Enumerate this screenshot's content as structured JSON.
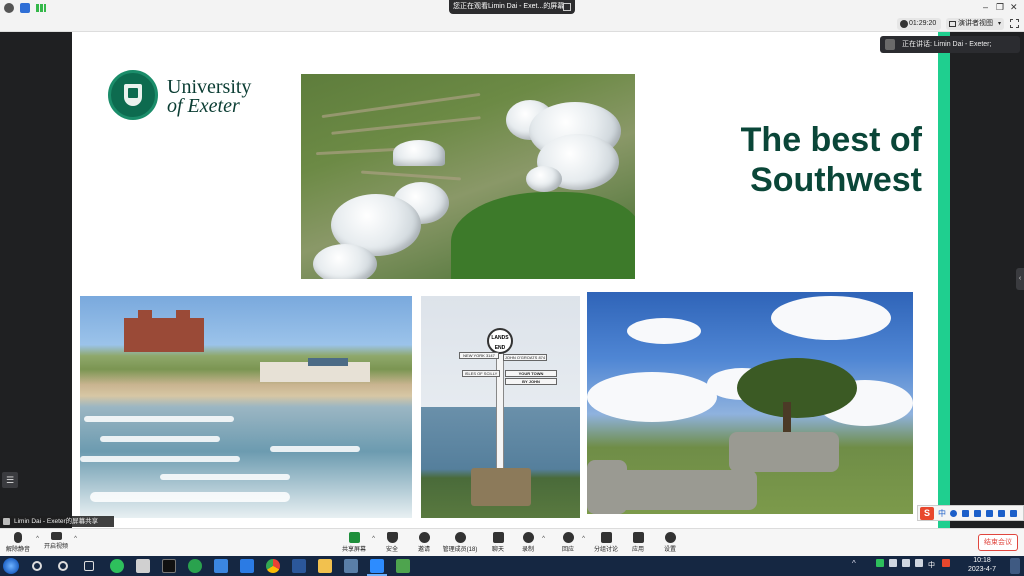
{
  "top_bar": {
    "share_banner": "您正在观看Limin Dai - Exet...的屏幕",
    "window_controls": [
      "–",
      "❐",
      "✕"
    ]
  },
  "sub_bar": {
    "timer": "01:29:20",
    "view_button": "演讲者视图"
  },
  "speaker_pill": "正在讲话: Limin Dai - Exeter;",
  "name_tag": "Limin Dai - Exeter的屏幕共享",
  "slide": {
    "university_line1": "University",
    "university_line2": "of Exeter",
    "title": "The best of Southwest",
    "accent_color": "#1fcf8f",
    "title_color": "#0a4638",
    "sign": {
      "top": "LANDS END",
      "arm1": "NEW YORK 3147",
      "arm2": "JOHN O'GROATS 874",
      "arm3": "ISLES OF SCILLY",
      "arm4": "YOUR TOWN",
      "arm5": "BY JOHN"
    }
  },
  "toolbar": {
    "unmute": "解除静音",
    "start_video": "开启视频",
    "share_screen": "共享屏幕",
    "security": "安全",
    "invite": "邀请",
    "manage_participants": "管理成员(18)",
    "chat": "聊天",
    "record": "录制",
    "reactions": "回应",
    "breakout": "分组讨论",
    "apps": "应用",
    "settings": "设置",
    "end_meeting": "结束会议",
    "end_color": "#e0463e"
  },
  "ime": {
    "logo": "S",
    "mode": "中"
  },
  "taskbar": {
    "time": "10:18",
    "date": "2023-4-7",
    "lang": "中"
  }
}
